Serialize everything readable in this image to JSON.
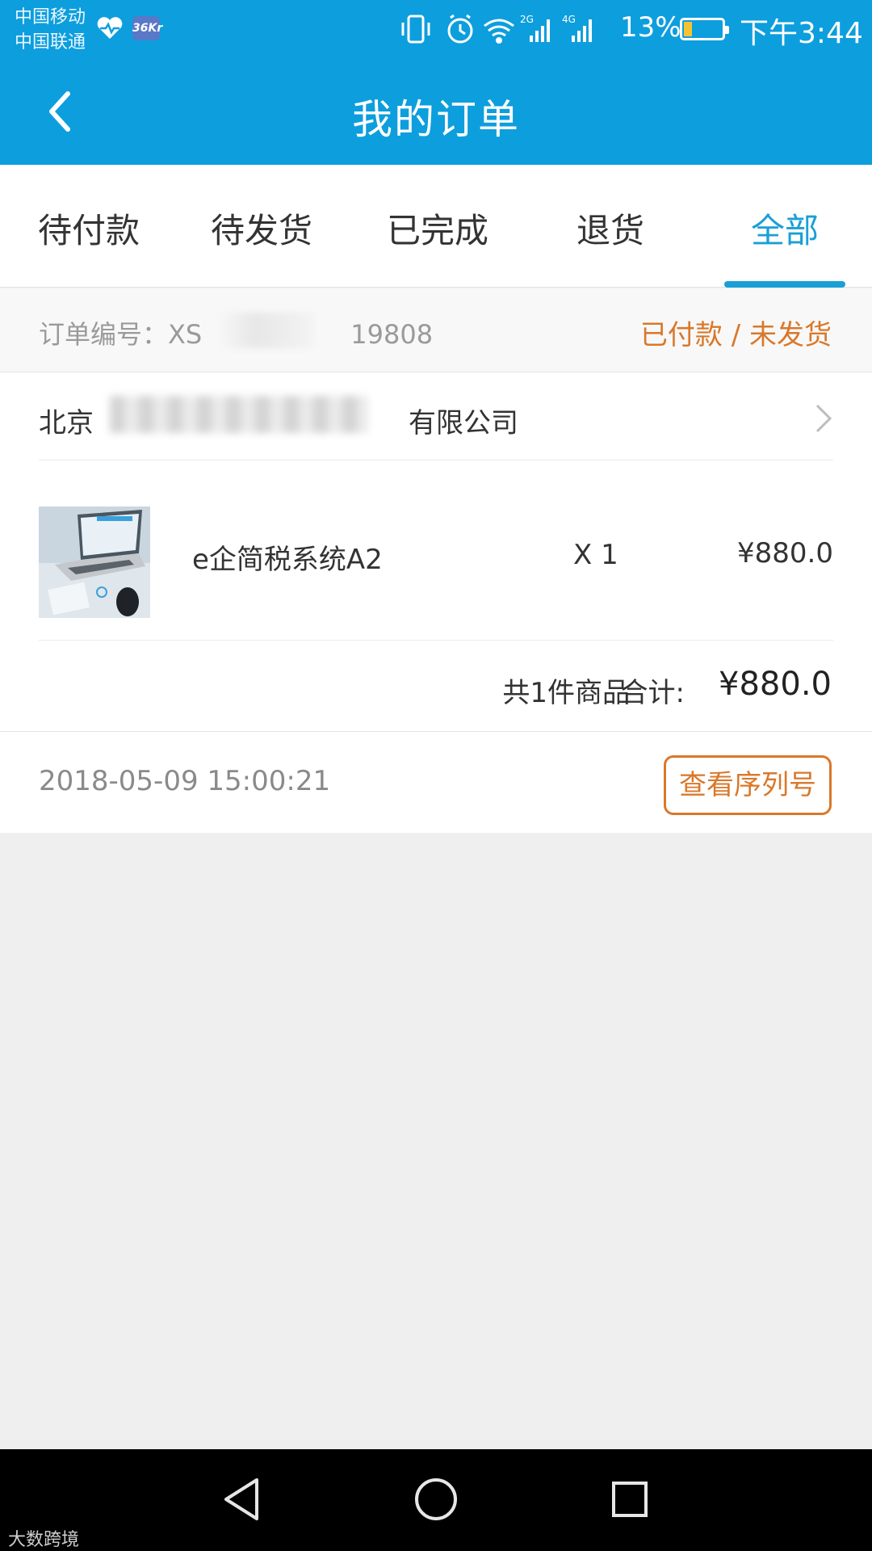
{
  "status_bar": {
    "carrier_1": "中国移动",
    "carrier_2": "中国联通",
    "app_badge": "36Kr",
    "network_1": "2G",
    "network_2": "4G",
    "battery": "13%",
    "time": "下午3:44"
  },
  "header": {
    "title": "我的订单"
  },
  "tabs": [
    {
      "label": "待付款",
      "active": false
    },
    {
      "label": "待发货",
      "active": false
    },
    {
      "label": "已完成",
      "active": false
    },
    {
      "label": "退货",
      "active": false
    },
    {
      "label": "全部",
      "active": true
    }
  ],
  "order": {
    "number_label": "订单编号：XS",
    "number_tail": "19808",
    "status": "已付款 / 未发货",
    "company_prefix": "北京",
    "company_suffix": "有限公司",
    "item": {
      "name": "e企简税系统A2",
      "quantity": "X 1",
      "price": "¥880.0"
    },
    "total_count": "共1件商品",
    "total_label": "合计:",
    "total_amount": "¥880.0",
    "datetime": "2018-05-09 15:00:21",
    "serial_button": "查看序列号"
  },
  "nav": {
    "back": "triangle-back",
    "home": "circle-home",
    "recent": "square-recent"
  },
  "watermark": "大数跨境",
  "colors": {
    "header_bg": "#0d9edd",
    "accent_blue": "#1a9fd6",
    "accent_orange": "#d9782b"
  }
}
